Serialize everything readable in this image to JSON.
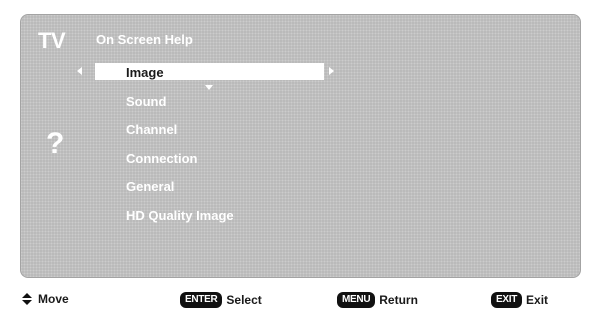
{
  "header": {
    "tv_label": "TV",
    "title": "On Screen Help"
  },
  "help_icon": "?",
  "menu": {
    "items": [
      {
        "label": "Image",
        "selected": true
      },
      {
        "label": "Sound",
        "selected": false
      },
      {
        "label": "Channel",
        "selected": false
      },
      {
        "label": "Connection",
        "selected": false
      },
      {
        "label": "General",
        "selected": false
      },
      {
        "label": "HD Quality Image",
        "selected": false
      }
    ]
  },
  "footer": {
    "move_label": "Move",
    "select_key": "ENTER",
    "select_label": "Select",
    "return_key": "MENU",
    "return_label": "Return",
    "exit_key": "EXIT",
    "exit_label": "Exit"
  },
  "colors": {
    "panel_background": "#b9b9b9",
    "highlight": "#ffffff",
    "key_background": "#111111",
    "text_light": "#ffffff",
    "text_dark": "#1a1a1a"
  },
  "icons": {
    "move": "up-down-arrows-icon",
    "nav_left": "chevron-left-icon",
    "nav_right": "chevron-right-icon",
    "scroll_down": "chevron-down-icon"
  }
}
